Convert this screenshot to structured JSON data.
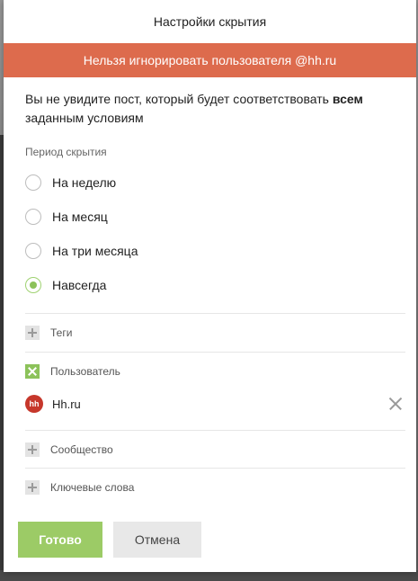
{
  "modal": {
    "title": "Настройки скрытия",
    "banner": "Нельзя игнорировать пользователя @hh.ru",
    "description_before": "Вы не увидите пост, который будет соответствовать ",
    "description_bold": "всем",
    "description_after": " заданным условиям"
  },
  "period": {
    "label": "Период скрытия",
    "options": [
      {
        "label": "На неделю",
        "selected": false
      },
      {
        "label": "На месяц",
        "selected": false
      },
      {
        "label": "На три месяца",
        "selected": false
      },
      {
        "label": "Навсегда",
        "selected": true
      }
    ]
  },
  "filters": {
    "tags_label": "Теги",
    "user_label": "Пользователь",
    "user_value": "Hh.ru",
    "user_avatar_text": "hh",
    "community_label": "Сообщество",
    "keywords_label": "Ключевые слова"
  },
  "buttons": {
    "done": "Готово",
    "cancel": "Отмена"
  },
  "colors": {
    "banner": "#dd6b4d",
    "accent_green": "#8cc25a",
    "avatar_red": "#c6372b"
  }
}
